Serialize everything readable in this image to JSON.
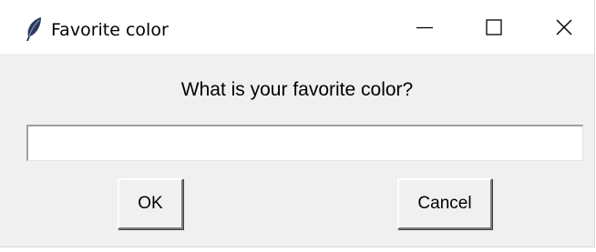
{
  "window": {
    "title": "Favorite color",
    "app_icon": "feather-icon",
    "controls": {
      "minimize": "minimize-icon",
      "maximize": "maximize-icon",
      "close": "close-icon"
    }
  },
  "dialog": {
    "prompt": "What is your favorite color?",
    "entry": {
      "value": "",
      "placeholder": ""
    },
    "ok_label": "OK",
    "cancel_label": "Cancel"
  },
  "colors": {
    "titlebar_bg": "#ffffff",
    "dialog_bg": "#f0f0f0",
    "feather_icon": "#2a3a5c"
  }
}
